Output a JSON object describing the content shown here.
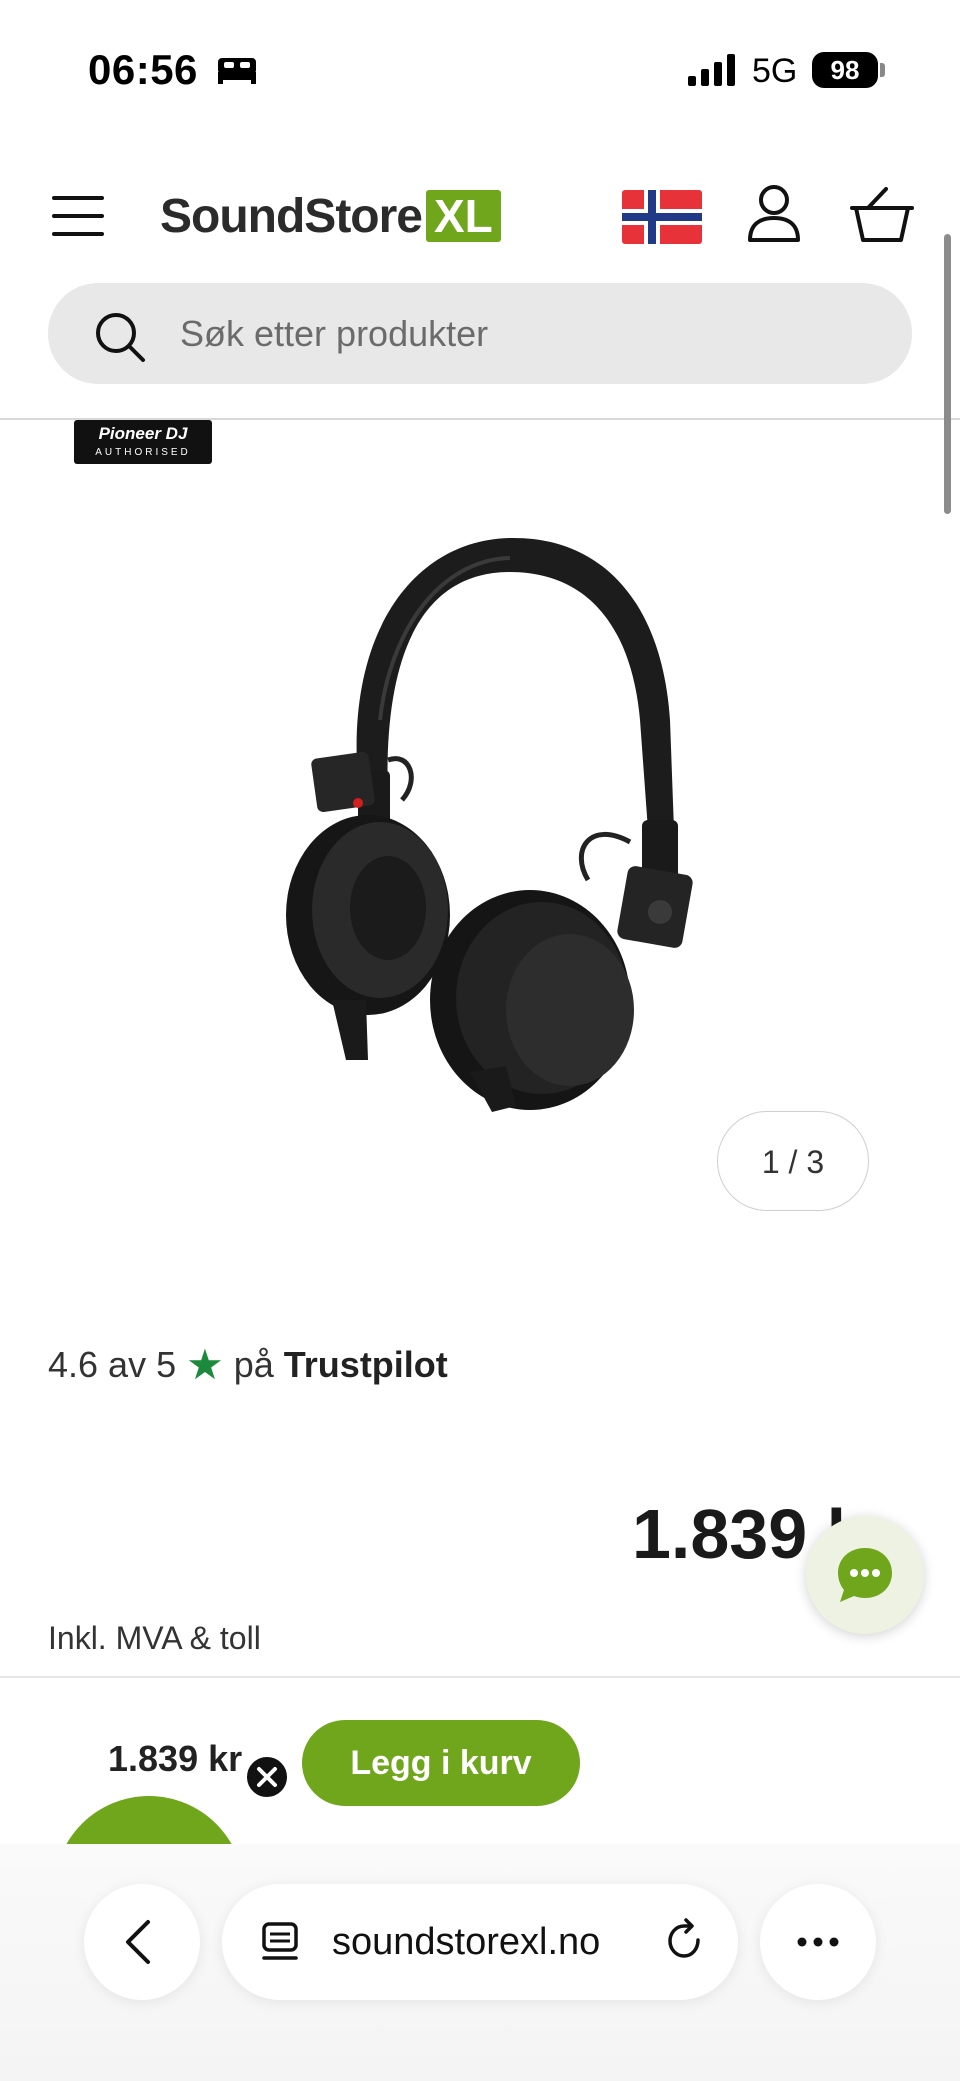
{
  "status_bar": {
    "time": "06:56",
    "network": "5G",
    "battery": "98"
  },
  "header": {
    "logo_text": "SoundStore",
    "logo_suffix": "XL",
    "brand_color": "#6fa61c",
    "icons": [
      "menu-icon",
      "norway-flag-icon",
      "user-icon",
      "basket-icon"
    ]
  },
  "search": {
    "placeholder": "Søk etter produkter"
  },
  "product": {
    "badge_top": "Pioneer DJ",
    "badge_bottom": "AUTHORISED",
    "gallery_counter": "1 / 3",
    "rating_prefix": "4.6 av 5",
    "rating_star": "★",
    "rating_on": "på",
    "rating_source": "Trustpilot",
    "rating_star_color": "#1c8a3c",
    "price": "1.839 kr",
    "price_note": "Inkl. MVA & toll"
  },
  "sticky_bar": {
    "price": "1.839 kr",
    "add_to_cart_label": "Legg i kurv"
  },
  "browser": {
    "url": "soundstorexl.no"
  }
}
